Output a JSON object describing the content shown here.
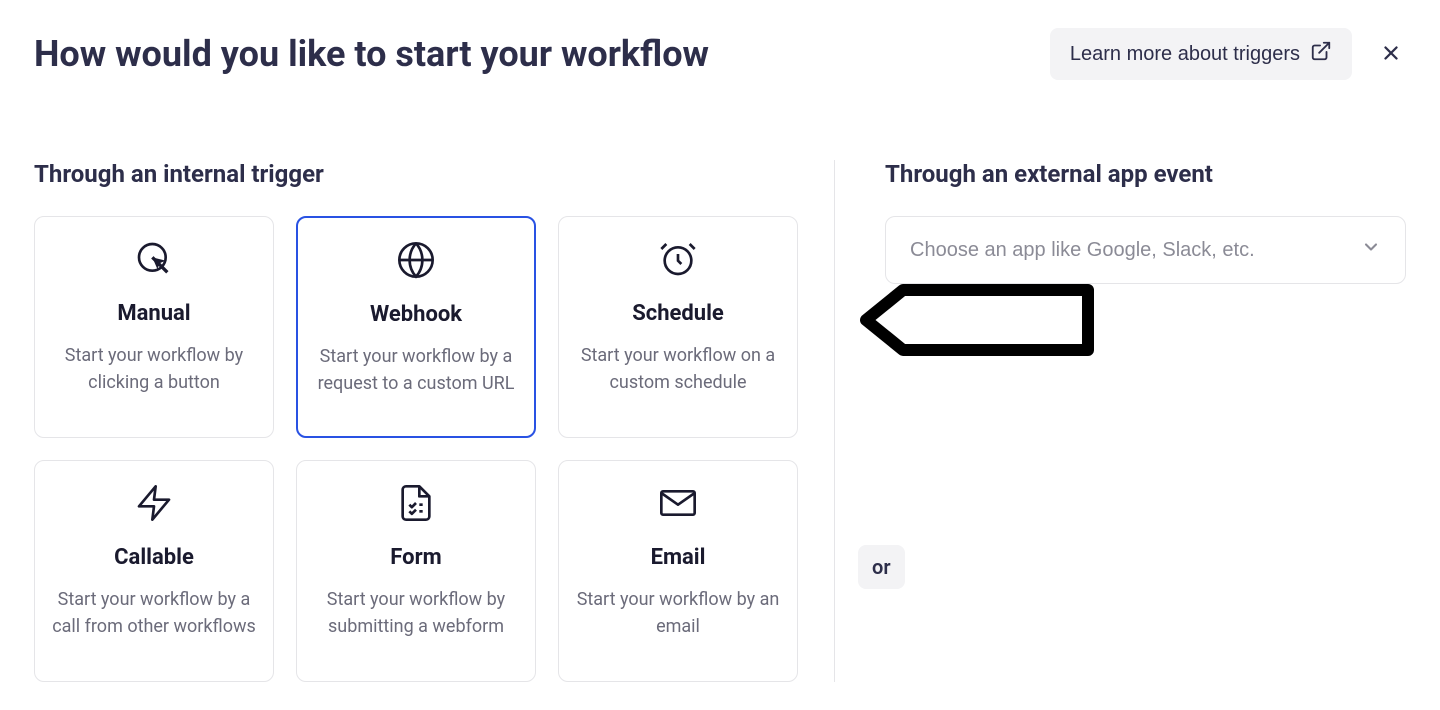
{
  "header": {
    "title": "How would you like to start your workflow",
    "learn_more_label": "Learn more about triggers"
  },
  "left": {
    "title": "Through an internal trigger",
    "cards": [
      {
        "title": "Manual",
        "desc": "Start your workflow by clicking a button"
      },
      {
        "title": "Webhook",
        "desc": "Start your workflow by a request to a custom URL"
      },
      {
        "title": "Schedule",
        "desc": "Start your workflow on a custom schedule"
      },
      {
        "title": "Callable",
        "desc": "Start your workflow by a call from other workflows"
      },
      {
        "title": "Form",
        "desc": "Start your workflow by submitting a webform"
      },
      {
        "title": "Email",
        "desc": "Start your workflow by an email"
      }
    ]
  },
  "right": {
    "title": "Through an external app event",
    "placeholder": "Choose an app like Google, Slack, etc."
  },
  "divider_label": "or"
}
